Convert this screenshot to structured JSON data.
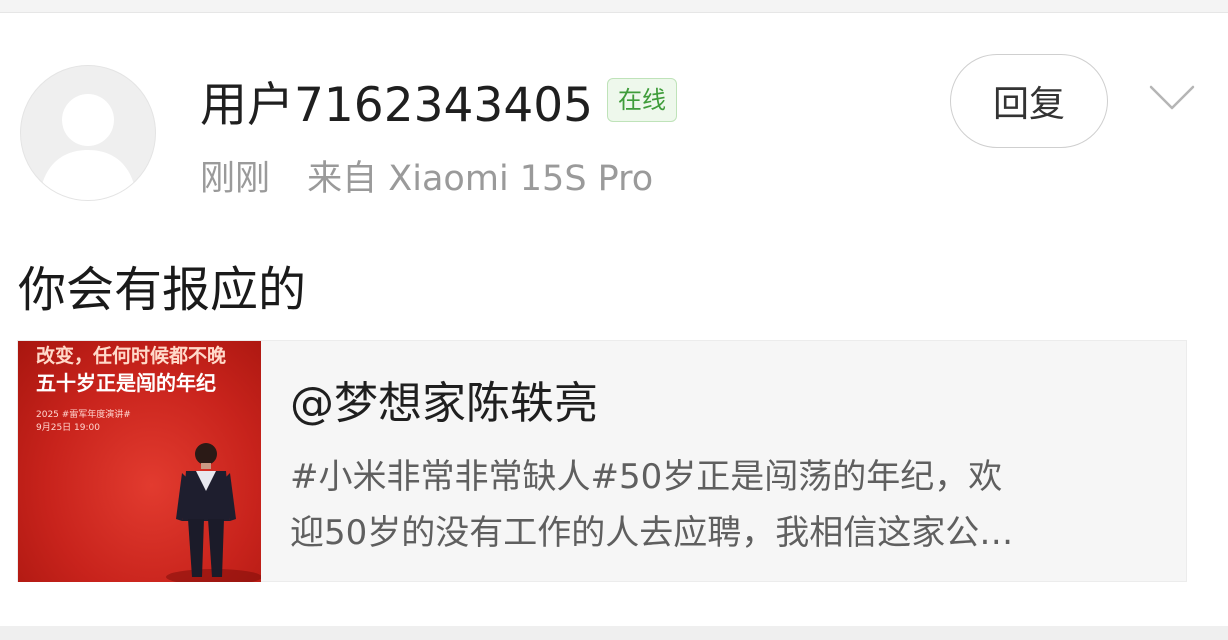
{
  "post": {
    "username": "用户7162343405",
    "online_badge": "在线",
    "time": "刚刚",
    "source": "来自 Xiaomi 15S Pro",
    "reply_label": "回复",
    "comment_text": "你会有报应的"
  },
  "shared_card": {
    "title": "@梦想家陈轶亮",
    "desc_line1": "#小米非常非常缺人#50岁正是闯荡的年纪，欢",
    "desc_line2": "迎50岁的没有工作的人去应聘，我相信这家公…",
    "thumbnail": {
      "line1": "改变，任何时候都不晚",
      "line2": "五十岁正是闯的年纪",
      "line3": "2025 #雷军年度演讲#",
      "line4": "9月25日 19:00"
    }
  },
  "colors": {
    "online_green": "#3f9c3a",
    "thumbnail_red": "#c8231c"
  }
}
